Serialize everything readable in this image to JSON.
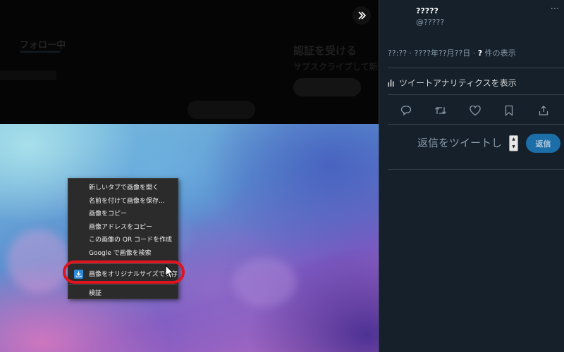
{
  "background_page": {
    "tabs": [
      "フォロー中",
      "",
      "",
      ""
    ],
    "promo_title": "認証を受ける",
    "promo_subtitle": "サブスクライブして新",
    "promo_button": "",
    "section_label": "",
    "follow_button": ""
  },
  "context_menu": {
    "items": [
      "新しいタブで画像を開く",
      "名前を付けて画像を保存...",
      "画像をコピー",
      "画像アドレスをコピー",
      "この画像の QR コードを作成",
      "Google で画像を検索"
    ],
    "extension_item": "画像をオリジナルサイズで保存",
    "inspect_item": "検証"
  },
  "tweet_panel": {
    "user_name": "?????",
    "user_handle": "@?????",
    "more_icon": "more-icon",
    "timestamp": "??:?? · ????年??月??日 · ",
    "views_count": "?",
    "views_label": " 件の表示",
    "analytics_label": "ツイートアナリティクスを表示",
    "reply_placeholder": "返信をツイートし",
    "reply_button": "返信"
  },
  "colors": {
    "panel_bg": "#15202b",
    "highlight": "#e0141e",
    "reply_button": "#1b6ea8",
    "menu_bg": "#2b2b2b"
  }
}
